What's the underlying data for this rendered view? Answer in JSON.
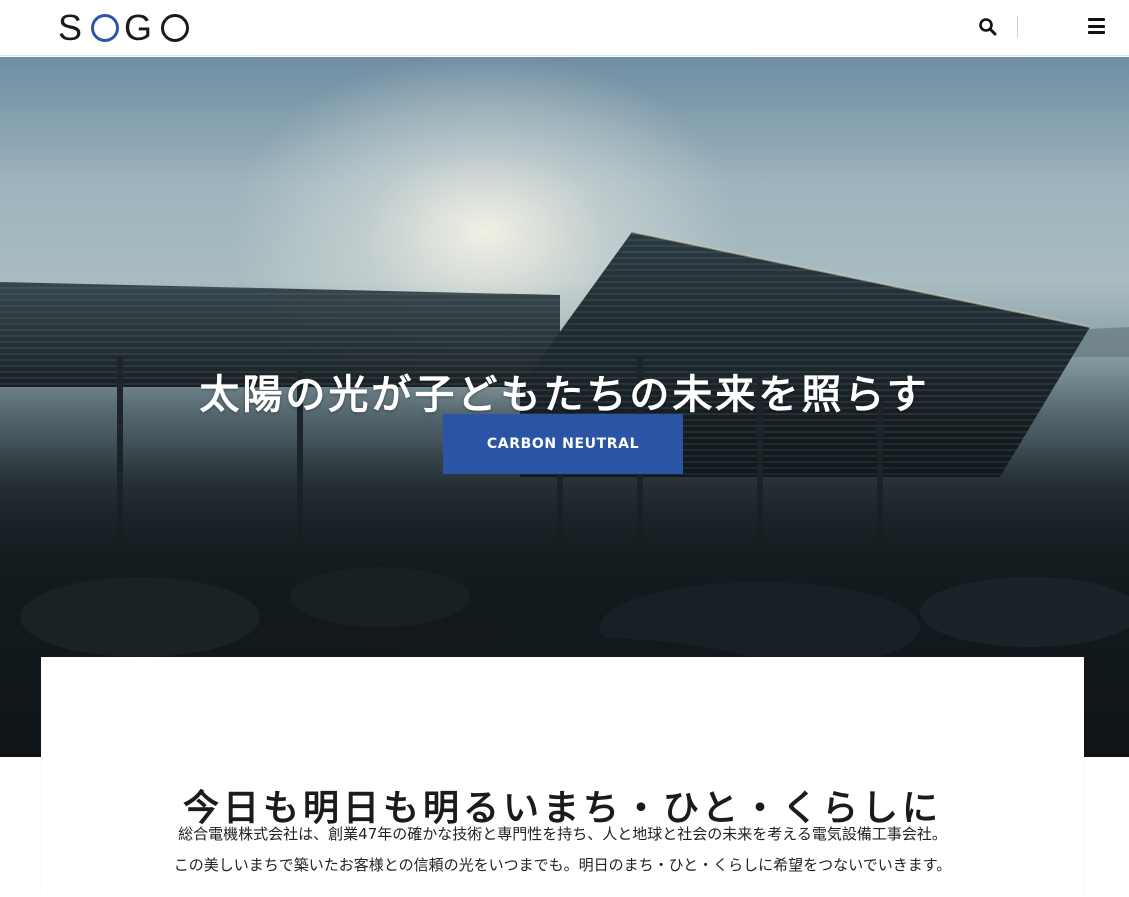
{
  "header": {
    "logo": {
      "letters": [
        "S",
        "O",
        "G",
        "O"
      ],
      "brand_color": "#2c55a8"
    },
    "search_icon": "search-icon",
    "menu_icon": "hamburger-menu-icon"
  },
  "hero": {
    "title": "太陽の光が子どもたちの未来を照らす",
    "cta_label": "CARBON NEUTRAL",
    "cta_color": "#2a55a6"
  },
  "intro": {
    "heading": "今日も明日も明るいまち・ひと・くらしに",
    "paragraph_lines": [
      "総合電機株式会社は、創業47年の確かな技術と専門性を持ち、人と地球と社会の未来を考える電気設備工事会社。",
      "この美しいまちで築いたお客様との信頼の光をいつまでも。明日のまち・ひと・くらしに希望をつないでいきます。"
    ]
  }
}
